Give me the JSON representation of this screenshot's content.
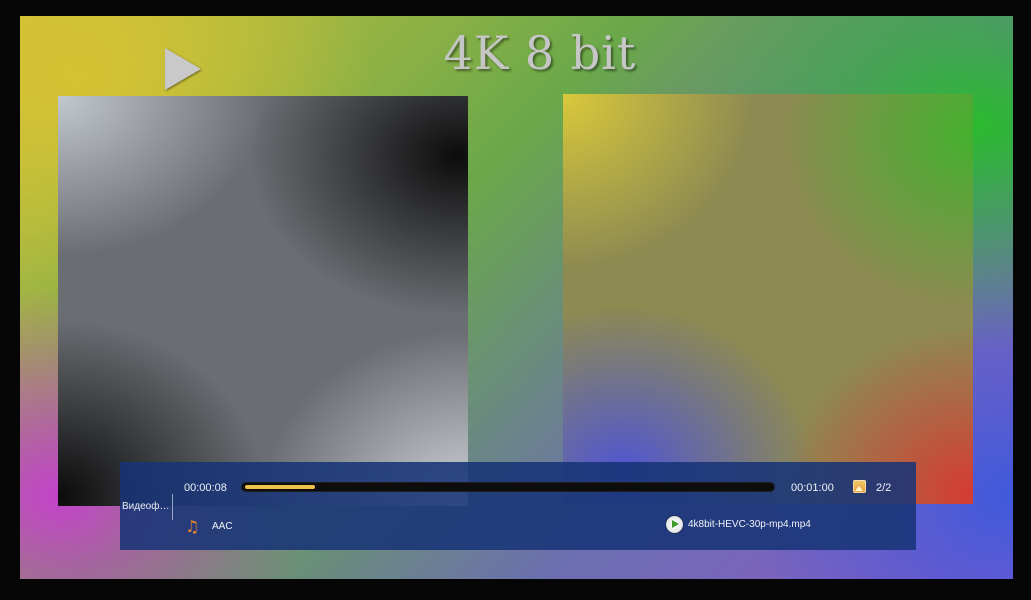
{
  "video": {
    "title": "4K 8 bit"
  },
  "player": {
    "side_tab_label": "Видеоф…",
    "time_current": "00:00:08",
    "time_total": "00:01:00",
    "progress_fraction": 0.133,
    "page_counter": "2/2",
    "audio_codec": "AAC",
    "file_name": "4k8bit-HEVC-30p-mp4.mp4",
    "icons": {
      "play_indicator": "play-triangle-icon",
      "picture": "picture-icon",
      "audio": "music-note-icon",
      "file": "play-circle-icon"
    },
    "colors": {
      "progress_fill": "#f1c24a",
      "bar_background": "#183476",
      "audio_icon": "#f08a2a"
    }
  }
}
